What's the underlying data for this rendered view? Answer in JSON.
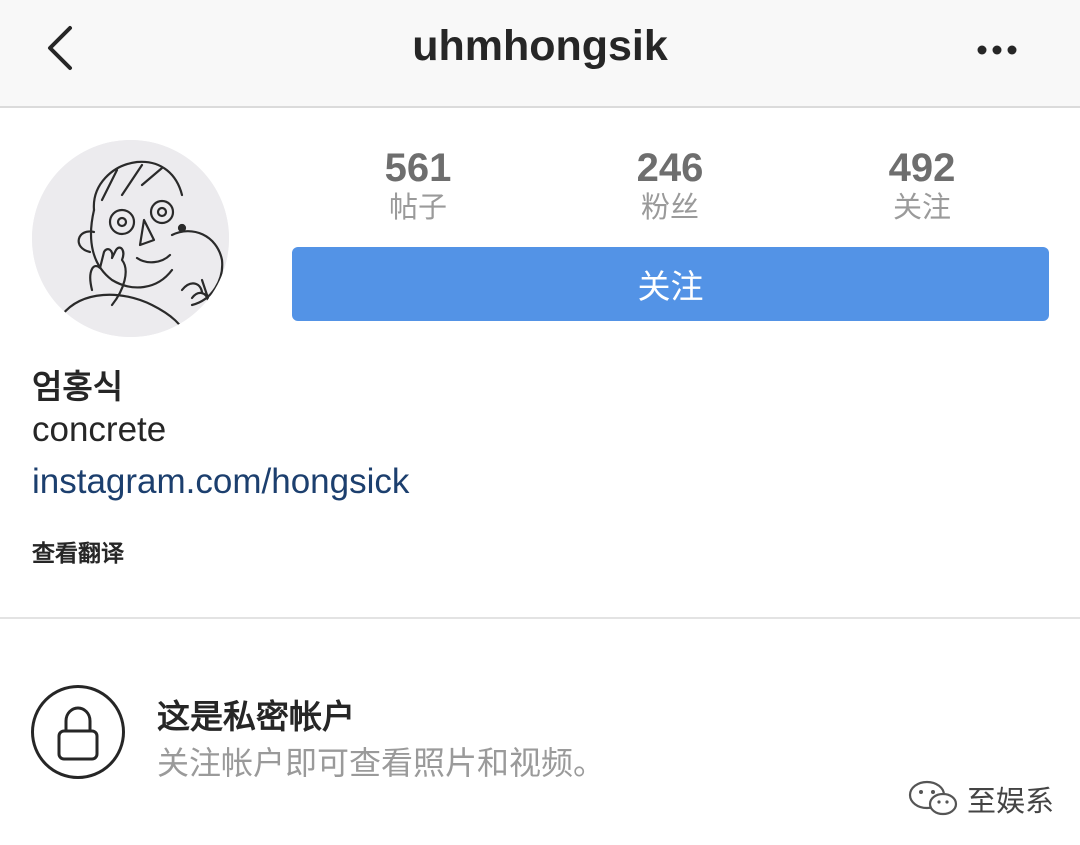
{
  "nav": {
    "username": "uhmhongsik",
    "back_icon": "chevron-left-icon",
    "more_icon": "more-horizontal-icon"
  },
  "profile": {
    "avatar": "hand-drawn-doodle-avatar",
    "stats": [
      {
        "value": "561",
        "label": "帖子"
      },
      {
        "value": "246",
        "label": "粉丝"
      },
      {
        "value": "492",
        "label": "关注"
      }
    ],
    "follow_label": "关注",
    "follow_color": "#5393e6",
    "full_name": "엄홍식",
    "bio": "concrete",
    "link": "instagram.com/hongsick",
    "translate_label": "查看翻译"
  },
  "private_notice": {
    "icon": "lock-icon",
    "title": "这是私密帐户",
    "subtitle": "关注帐户即可查看照片和视频。"
  },
  "watermark": {
    "icon": "wechat-logo-icon",
    "text": "至娱系"
  }
}
